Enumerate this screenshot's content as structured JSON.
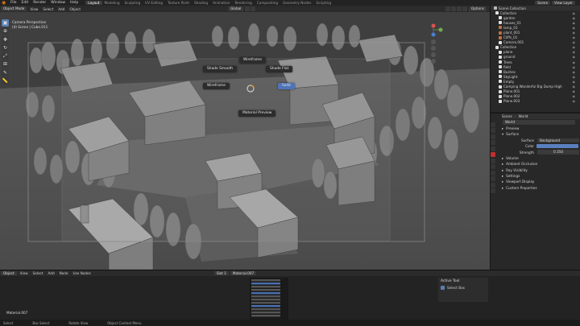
{
  "topbar": {
    "menus": [
      "File",
      "Edit",
      "Render",
      "Window",
      "Help"
    ],
    "tabs": [
      "Layout",
      "Modeling",
      "Sculpting",
      "UV Editing",
      "Texture Paint",
      "Shading",
      "Animation",
      "Rendering",
      "Compositing",
      "Geometry Nodes",
      "Scripting"
    ],
    "active_tab": "Layout",
    "scene_label": "Scene",
    "view_layer_label": "View Layer"
  },
  "viewport_header": {
    "mode": "Object Mode",
    "menus": [
      "View",
      "Select",
      "Add",
      "Object"
    ],
    "orientation": "Global",
    "options": "Options"
  },
  "viewport": {
    "camera_label": "Camera Perspective",
    "collection_label": "(4) Scene | Cube.011",
    "pie_menu": {
      "top": "Wireframe",
      "left": "Shade Smooth",
      "right": "Shade Flat",
      "far_left": "Wireframe",
      "selected": "Solid",
      "bottom": "Material Preview"
    }
  },
  "outliner": {
    "title": "Scene Collection",
    "rows": [
      {
        "label": "Collection",
        "color": "#e0e0e0"
      },
      {
        "label": "garden",
        "color": "#e0e0e0"
      },
      {
        "label": "houses_01",
        "color": "#e0e0e0"
      },
      {
        "label": "lamp_03",
        "color": "#c07040"
      },
      {
        "label": "plant_001",
        "color": "#c07040"
      },
      {
        "label": "Cliffs_01",
        "color": "#c07040"
      },
      {
        "label": "Camera.001",
        "color": "#e0e0e0"
      },
      {
        "label": "Collection",
        "color": "#e0e0e0"
      },
      {
        "label": "plane",
        "color": "#e0e0e0"
      },
      {
        "label": "ground",
        "color": "#e0e0e0"
      },
      {
        "label": "Trees",
        "color": "#e0e0e0"
      },
      {
        "label": "field",
        "color": "#e0e0e0"
      },
      {
        "label": "Bushes",
        "color": "#e0e0e0"
      },
      {
        "label": "SkyLight",
        "color": "#e0e0e0"
      },
      {
        "label": "Empty",
        "color": "#e0e0e0"
      },
      {
        "label": "Camping Wonderful Big Dump High",
        "color": "#e0e0e0"
      },
      {
        "label": "Plane.001",
        "color": "#e0e0e0"
      },
      {
        "label": "Plane.002",
        "color": "#e0e0e0"
      },
      {
        "label": "Plane.003",
        "color": "#e0e0e0"
      }
    ]
  },
  "properties": {
    "scene_label": "Scene",
    "world_label": "World",
    "world_name": "World",
    "sections": [
      "Preview",
      "Surface"
    ],
    "surface_label": "Surface",
    "surface_value": "Background",
    "color_label": "Color",
    "color_value": "#5a7fc0",
    "strength_label": "Strength",
    "strength_value": "0.350",
    "subsections": [
      "Volume",
      "Ambient Occlusion",
      "Ray Visibility",
      "Settings",
      "Viewport Display",
      "Custom Properties"
    ]
  },
  "bottom": {
    "header_items": [
      "Object",
      "View",
      "Select",
      "Add",
      "Node",
      "Use Nodes"
    ],
    "slot": "Slot 1",
    "material": "Material.007",
    "left_label": "Material.007",
    "active_tool_title": "Active Tool",
    "active_tool_name": "Select Box"
  },
  "statusbar": {
    "items": [
      "Select",
      "Box Select",
      "Rotate View",
      "Object Context Menu"
    ]
  }
}
